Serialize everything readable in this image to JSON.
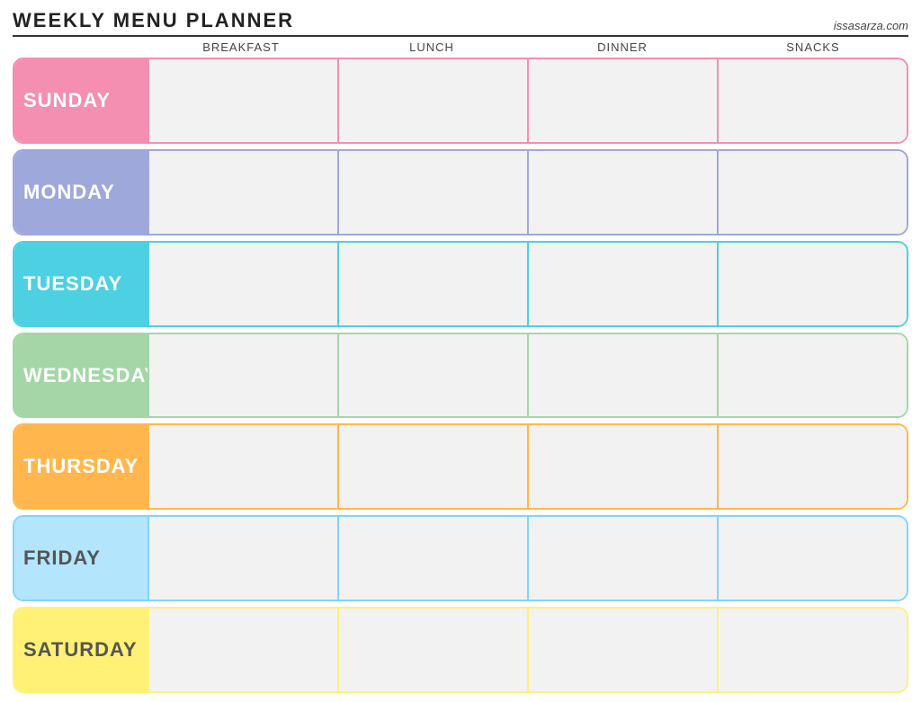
{
  "header": {
    "title": "Weekly Menu Planner",
    "website": "issasarza.com"
  },
  "columns": [
    "Breakfast",
    "Lunch",
    "Dinner",
    "Snacks"
  ],
  "days": [
    {
      "id": "sunday",
      "label": "Sunday",
      "class": "row-sunday"
    },
    {
      "id": "monday",
      "label": "Monday",
      "class": "row-monday"
    },
    {
      "id": "tuesday",
      "label": "Tuesday",
      "class": "row-tuesday"
    },
    {
      "id": "wednesday",
      "label": "Wednesday",
      "class": "row-wednesday"
    },
    {
      "id": "thursday",
      "label": "Thursday",
      "class": "row-thursday"
    },
    {
      "id": "friday",
      "label": "Friday",
      "class": "row-friday"
    },
    {
      "id": "saturday",
      "label": "Saturday",
      "class": "row-saturday"
    }
  ]
}
